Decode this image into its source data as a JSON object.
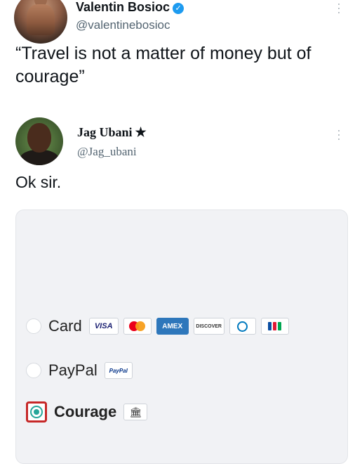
{
  "tweets": [
    {
      "name": "Valentin Bosioc",
      "handle": "@valentinebosioc",
      "verified_icon": "verified-badge-icon",
      "text": "“Travel is not a matter of money but of courage”"
    },
    {
      "name": "Jag Ubani",
      "name_suffix": "★",
      "handle": "@Jag_ubani",
      "text": "Ok sir."
    }
  ],
  "payment": {
    "options": [
      {
        "label": "Card",
        "selected": false
      },
      {
        "label": "PayPal",
        "selected": false
      },
      {
        "label": "Courage",
        "selected": true
      }
    ],
    "card_logos": {
      "visa": "VISA",
      "amex": "AMEX",
      "discover": "DISCOVER"
    },
    "paypal_logo": "PayPal",
    "bank_icon": "🏛"
  },
  "colors": {
    "verified": "#1d9bf0",
    "selected_outline": "#c62828",
    "selected_radio": "#26a69a"
  }
}
